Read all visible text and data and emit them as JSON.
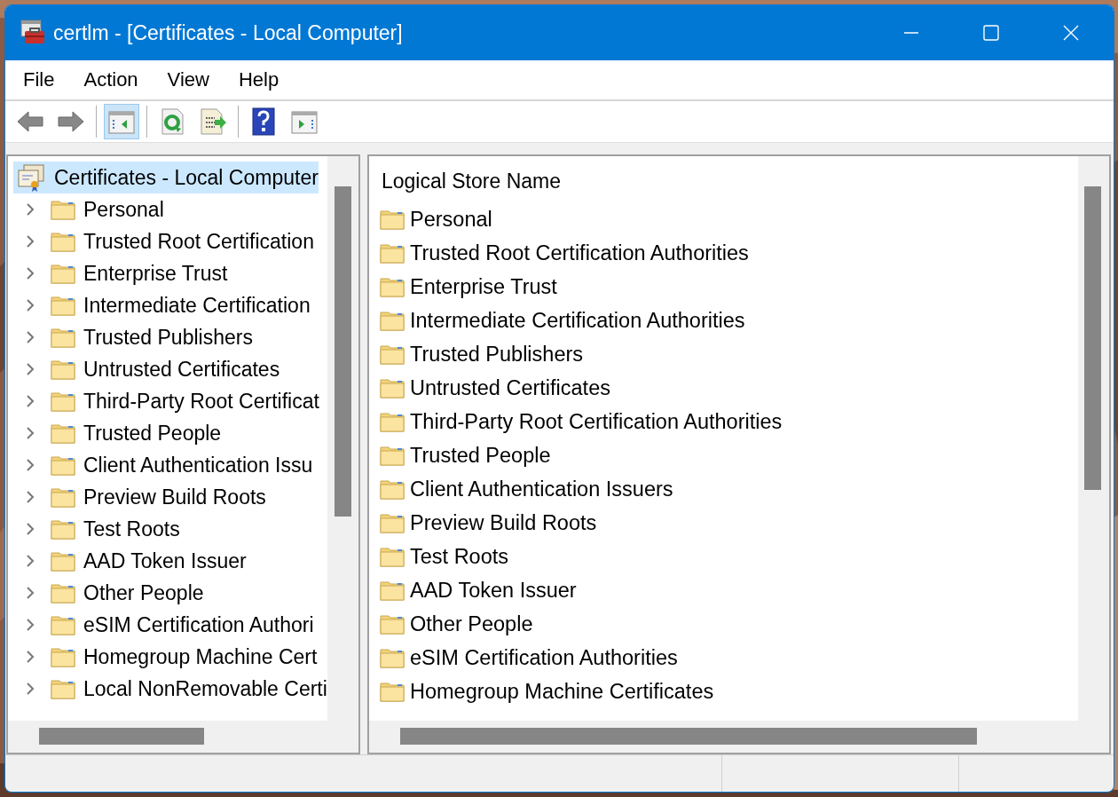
{
  "window": {
    "title": "certlm - [Certificates - Local Computer]"
  },
  "menu": [
    "File",
    "Action",
    "View",
    "Help"
  ],
  "toolbar": [
    {
      "kind": "back"
    },
    {
      "kind": "forward"
    },
    {
      "kind": "separator"
    },
    {
      "kind": "tree",
      "pressed": true
    },
    {
      "kind": "separator"
    },
    {
      "kind": "refresh"
    },
    {
      "kind": "export"
    },
    {
      "kind": "separator"
    },
    {
      "kind": "help"
    },
    {
      "kind": "action-pane"
    }
  ],
  "tree": {
    "root": {
      "label": "Certificates - Local Computer",
      "selected": true
    },
    "items": [
      {
        "label": "Personal",
        "expanded": false
      },
      {
        "label": "Trusted Root Certification",
        "expanded": false
      },
      {
        "label": "Enterprise Trust",
        "expanded": false
      },
      {
        "label": "Intermediate Certification",
        "expanded": false
      },
      {
        "label": "Trusted Publishers",
        "expanded": false
      },
      {
        "label": "Untrusted Certificates",
        "expanded": false
      },
      {
        "label": "Third-Party Root Certificat",
        "expanded": false
      },
      {
        "label": "Trusted People",
        "expanded": false
      },
      {
        "label": "Client Authentication Issu",
        "expanded": false
      },
      {
        "label": "Preview Build Roots",
        "expanded": false
      },
      {
        "label": "Test Roots",
        "expanded": false
      },
      {
        "label": "AAD Token Issuer",
        "expanded": false
      },
      {
        "label": "Other People",
        "expanded": false
      },
      {
        "label": "eSIM Certification Authori",
        "expanded": false
      },
      {
        "label": "Homegroup Machine Cert",
        "expanded": false
      },
      {
        "label": "Local NonRemovable Certi",
        "expanded": false
      }
    ]
  },
  "list": {
    "column": "Logical Store Name",
    "rows": [
      "Personal",
      "Trusted Root Certification Authorities",
      "Enterprise Trust",
      "Intermediate Certification Authorities",
      "Trusted Publishers",
      "Untrusted Certificates",
      "Third-Party Root Certification Authorities",
      "Trusted People",
      "Client Authentication Issuers",
      "Preview Build Roots",
      "Test Roots",
      "AAD Token Issuer",
      "Other People",
      "eSIM Certification Authorities",
      "Homegroup Machine Certificates"
    ]
  }
}
